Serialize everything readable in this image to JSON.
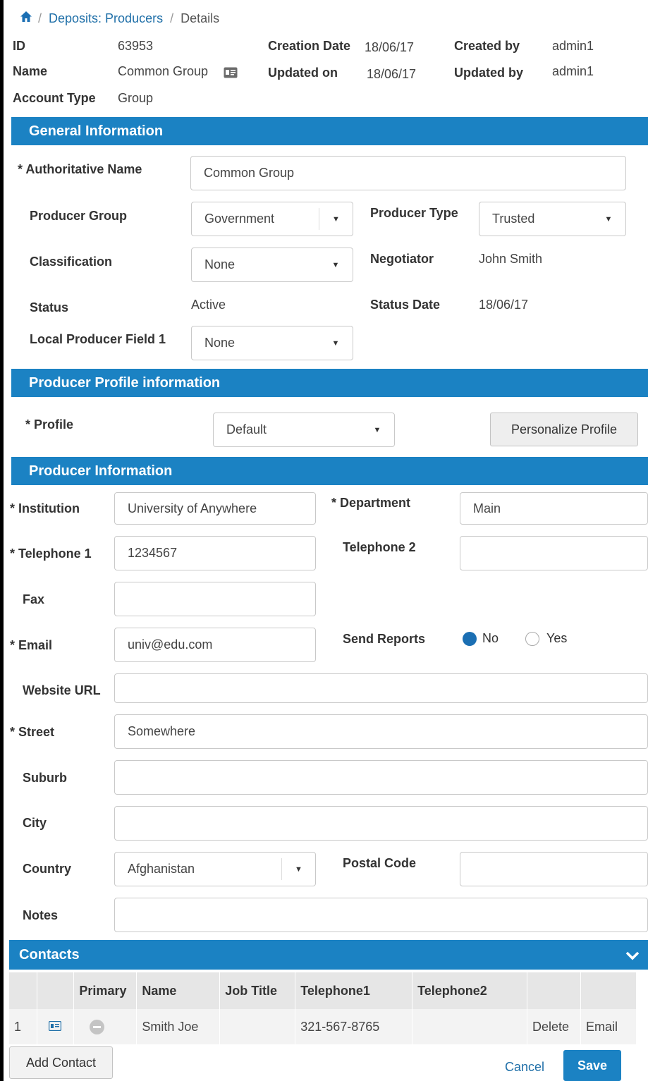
{
  "breadcrumb": {
    "section": "Deposits: Producers",
    "sep": "/",
    "current": "Details"
  },
  "header": {
    "id_label": "ID",
    "id_value": "63953",
    "name_label": "Name",
    "name_value": "Common Group",
    "account_type_label": "Account Type",
    "account_type_value": "Group",
    "creation_date_label": "Creation Date",
    "creation_date_value": "18/06/17",
    "updated_on_label": "Updated on",
    "updated_on_value": "18/06/17",
    "created_by_label": "Created by",
    "created_by_value": "admin1",
    "updated_by_label": "Updated by",
    "updated_by_value": "admin1"
  },
  "general": {
    "title": "General Information",
    "authoritative_name_label": "* Authoritative Name",
    "authoritative_name_value": "Common Group",
    "producer_group_label": "Producer Group",
    "producer_group_value": "Government",
    "producer_type_label": "Producer Type",
    "producer_type_value": "Trusted",
    "classification_label": "Classification",
    "classification_value": "None",
    "negotiator_label": "Negotiator",
    "negotiator_value": "John Smith",
    "status_label": "Status",
    "status_value": "Active",
    "status_date_label": "Status Date",
    "status_date_value": "18/06/17",
    "local_field_label": "Local Producer Field 1",
    "local_field_value": "None"
  },
  "profile": {
    "title": "Producer Profile information",
    "profile_label": "* Profile",
    "profile_value": "Default",
    "personalize_button": "Personalize Profile"
  },
  "producer": {
    "title": "Producer Information",
    "institution_label": "* Institution",
    "institution_value": "University of Anywhere",
    "department_label": "* Department",
    "department_value": "Main",
    "telephone1_label": "* Telephone 1",
    "telephone1_value": "1234567",
    "telephone2_label": "Telephone 2",
    "telephone2_value": "",
    "fax_label": "Fax",
    "fax_value": "",
    "email_label": "* Email",
    "email_value": "univ@edu.com",
    "send_reports_label": "Send Reports",
    "send_reports_no": "No",
    "send_reports_yes": "Yes",
    "send_reports_selected": "No",
    "website_label": "Website URL",
    "website_value": "",
    "street_label": "* Street",
    "street_value": "Somewhere",
    "suburb_label": "Suburb",
    "suburb_value": "",
    "city_label": "City",
    "city_value": "",
    "country_label": "Country",
    "country_value": "Afghanistan",
    "postal_label": "Postal Code",
    "postal_value": "",
    "notes_label": "Notes",
    "notes_value": ""
  },
  "contacts": {
    "title": "Contacts",
    "columns": [
      "",
      "",
      "Primary",
      "Name",
      "Job Title",
      "Telephone1",
      "Telephone2",
      "",
      ""
    ],
    "rows": [
      {
        "num": "1",
        "name": "Smith Joe",
        "job_title": "",
        "telephone1": "321-567-8765",
        "telephone2": "",
        "delete": "Delete",
        "email": "Email"
      }
    ],
    "add_button": "Add Contact"
  },
  "footer": {
    "cancel": "Cancel",
    "save": "Save"
  },
  "colors": {
    "accent": "#1b82c3",
    "link": "#1f6fa8",
    "save_button": "#1b82c3"
  },
  "icons": {
    "home": "home-icon",
    "card": "id-card-icon",
    "chevron": "chevron-down-icon",
    "caret": "caret-down-icon"
  }
}
